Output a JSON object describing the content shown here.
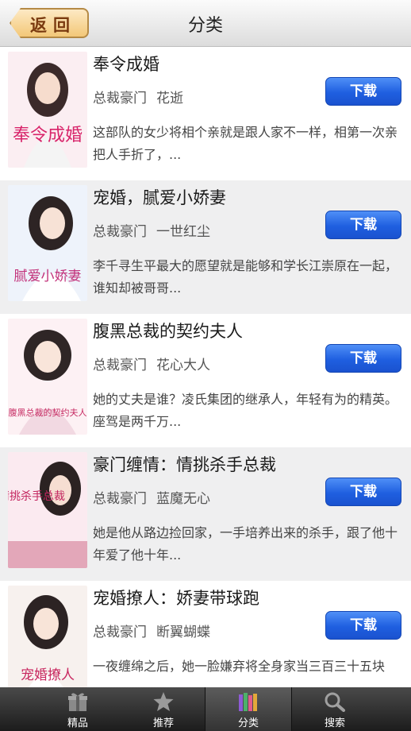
{
  "nav": {
    "back_label": "返回",
    "title": "分类"
  },
  "books": [
    {
      "title": "奉令成婚",
      "category": "总裁豪门",
      "author": "花逝",
      "download": "下载",
      "desc": "这部队的女少将相个亲就是跟人家不一样，相第一次亲把人手折了，...",
      "cover_text": "奉令成婚"
    },
    {
      "title": "宠婚，腻爱小娇妻",
      "category": "总裁豪门",
      "author": "一世红尘",
      "download": "下载",
      "desc": "李千寻生平最大的愿望就是能够和学长江崇原在一起，谁知却被哥哥...",
      "cover_text": "腻爱小娇妻"
    },
    {
      "title": "腹黑总裁的契约夫人",
      "category": "总裁豪门",
      "author": "花心大人",
      "download": "下载",
      "desc": "她的丈夫是谁？凌氏集团的继承人，年轻有为的精英。座驾是两千万...",
      "cover_text": "腹黑总裁的契约夫人"
    },
    {
      "title": "豪门缠情：情挑杀手总裁",
      "category": "总裁豪门",
      "author": "蓝魔无心",
      "download": "下载",
      "desc": "她是他从路边捡回家，一手培养出来的杀手，跟了他十年爱了他十年...",
      "cover_text": "情挑杀手总裁"
    },
    {
      "title": "宠婚撩人：娇妻带球跑",
      "category": "总裁豪门",
      "author": "断翼蝴蝶",
      "download": "下载",
      "desc": "一夜缠绵之后，她一脸嫌弃将全身家当三百三十五块",
      "cover_text": "宠婚撩人"
    }
  ],
  "tabs": [
    {
      "label": "精品",
      "icon": "gift-icon"
    },
    {
      "label": "推荐",
      "icon": "star-icon"
    },
    {
      "label": "分类",
      "icon": "books-icon",
      "selected": true
    },
    {
      "label": "搜索",
      "icon": "magnifier-icon"
    }
  ],
  "colors": {
    "download_button": "#2a68e6",
    "navbar": "#e6e6e6",
    "tabbar": "#2a2a2a",
    "back_button": "#f3c878"
  }
}
